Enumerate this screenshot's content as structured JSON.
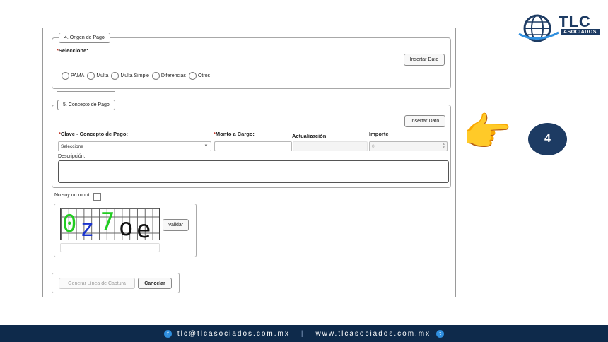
{
  "brand": {
    "name": "TLC",
    "subtitle": "ASOCIADOS",
    "color": "#1d3b63"
  },
  "section_origen": {
    "legend": "4. Origen de Pago",
    "required_mark": "*",
    "select_label": "Seleccione:",
    "insert_button": "Insertar Dato",
    "options": [
      "PAMA",
      "Multa",
      "Multa Simple",
      "Diferencias",
      "Otros"
    ]
  },
  "section_concepto": {
    "legend": "5. Concepto de Pago",
    "insert_button": "Insertar Dato",
    "required_mark": "*",
    "clave_label": "Clave - Concepto de Pago:",
    "monto_label": "Monto a Cargo:",
    "actualizacion_label": "Actualización",
    "importe_label": "Importe",
    "clave_value": "Seleccione",
    "importe_placeholder": "0",
    "descripcion_label": "Descripción:"
  },
  "captcha": {
    "robot_label": "No soy un robot",
    "validate_button": "Validar",
    "text": "0z7oe",
    "chars": [
      {
        "c": "0",
        "color": "#22cc22"
      },
      {
        "c": "z",
        "color": "#1a33cc"
      },
      {
        "c": "7",
        "color": "#22cc22"
      },
      {
        "c": "o",
        "color": "#111111"
      },
      {
        "c": "e",
        "color": "#111111"
      }
    ]
  },
  "actions": {
    "generate_button": "Generar Línea de Captura",
    "cancel_button": "Cancelar"
  },
  "footer": {
    "email": "tlc@tlcasociados.com.mx",
    "separator": "|",
    "website": "www.tlcasociados.com.mx",
    "facebook_glyph": "f",
    "twitter_glyph": "t"
  },
  "annotation": {
    "step_number": "4",
    "pointer_icon": "pointing-hand-icon"
  },
  "colors": {
    "footer_bg": "#0e2a4b",
    "accent": "#2f8fdf",
    "required": "#c0392b"
  }
}
